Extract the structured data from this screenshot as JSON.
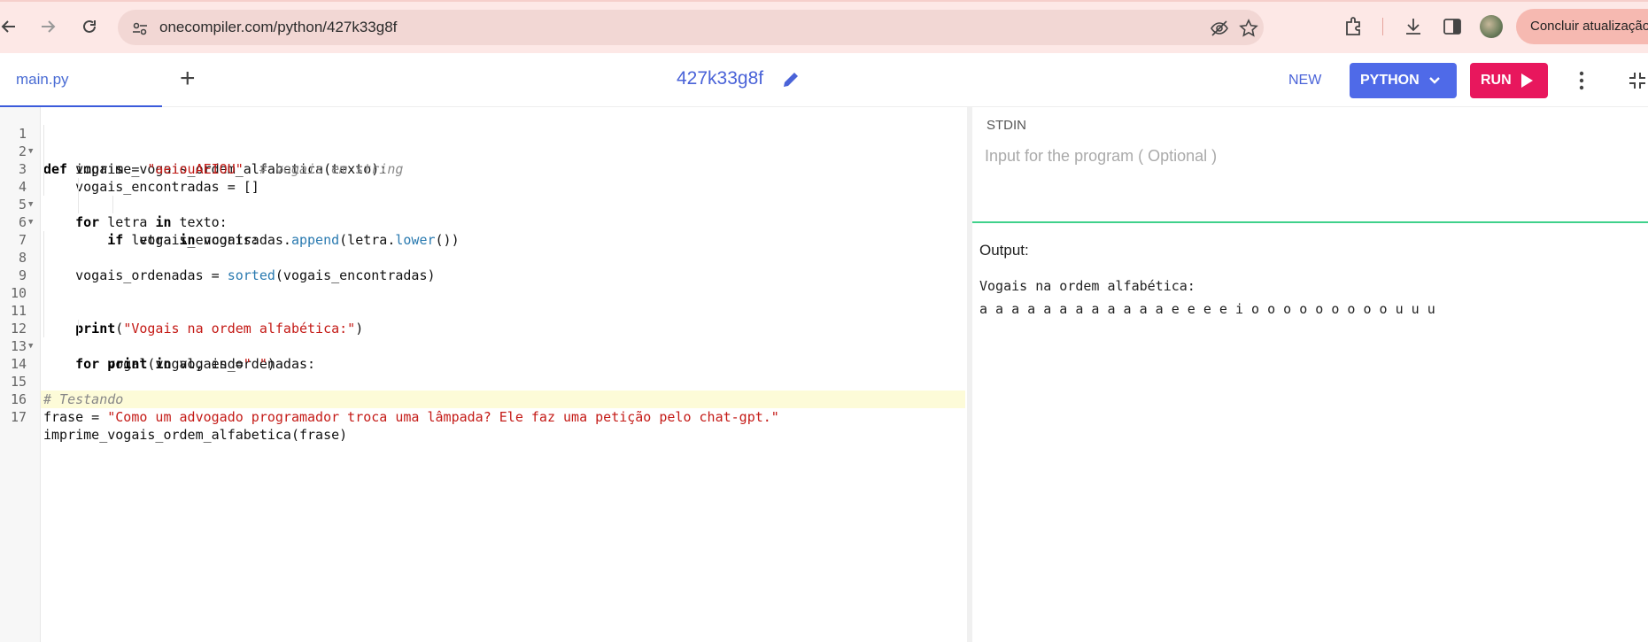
{
  "browser": {
    "url": "onecompiler.com/python/427k33g8f",
    "update_label": "Concluir atualização"
  },
  "header": {
    "file_tab": "main.py",
    "add_tab": "+",
    "program_id": "427k33g8f",
    "new_label": "NEW",
    "language_label": "PYTHON",
    "run_label": "RUN"
  },
  "editor": {
    "line_numbers": [
      "1",
      "2",
      "3",
      "4",
      "5",
      "6",
      "7",
      "8",
      "9",
      "10",
      "11",
      "12",
      "13",
      "14",
      "15",
      "16",
      "17"
    ],
    "active_line": 17
  },
  "stdin": {
    "label": "STDIN",
    "placeholder": "Input for the program ( Optional )"
  },
  "output": {
    "label": "Output:",
    "lines": [
      "Vogais na ordem alfabética:",
      "a a a a a a a a a a a a e e e e i o o o o o o o o o u u u"
    ]
  },
  "colors": {
    "accent_blue": "#4f6ae8",
    "run_pink": "#e8175d",
    "stdin_border_green": "#3fd18b"
  }
}
